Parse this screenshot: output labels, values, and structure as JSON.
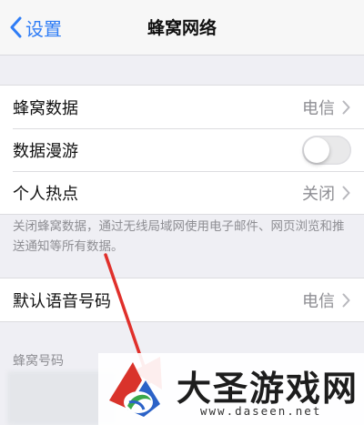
{
  "nav": {
    "back_label": "设置",
    "title": "蜂窝网络"
  },
  "group1": {
    "rows": [
      {
        "label": "蜂窝数据",
        "value": "电信"
      },
      {
        "label": "数据漫游",
        "toggle": "off"
      },
      {
        "label": "个人热点",
        "value": "关闭"
      }
    ],
    "footnote": "关闭蜂窝数据，通过无线局域网使用电子邮件、网页浏览和推送通知等所有数据。"
  },
  "group2": {
    "rows": [
      {
        "label": "默认语音号码",
        "value": "电信"
      }
    ]
  },
  "section_header": "蜂窝号码",
  "watermark": {
    "title": "大圣游戏网",
    "url": "www.daseen.net"
  },
  "colors": {
    "accent": "#2f7df6",
    "annotation_arrow": "#e0302b",
    "toggle_off": "#e9e9ea"
  },
  "icons": {
    "back": "chevron-left-icon",
    "disclosure": "chevron-right-icon"
  }
}
